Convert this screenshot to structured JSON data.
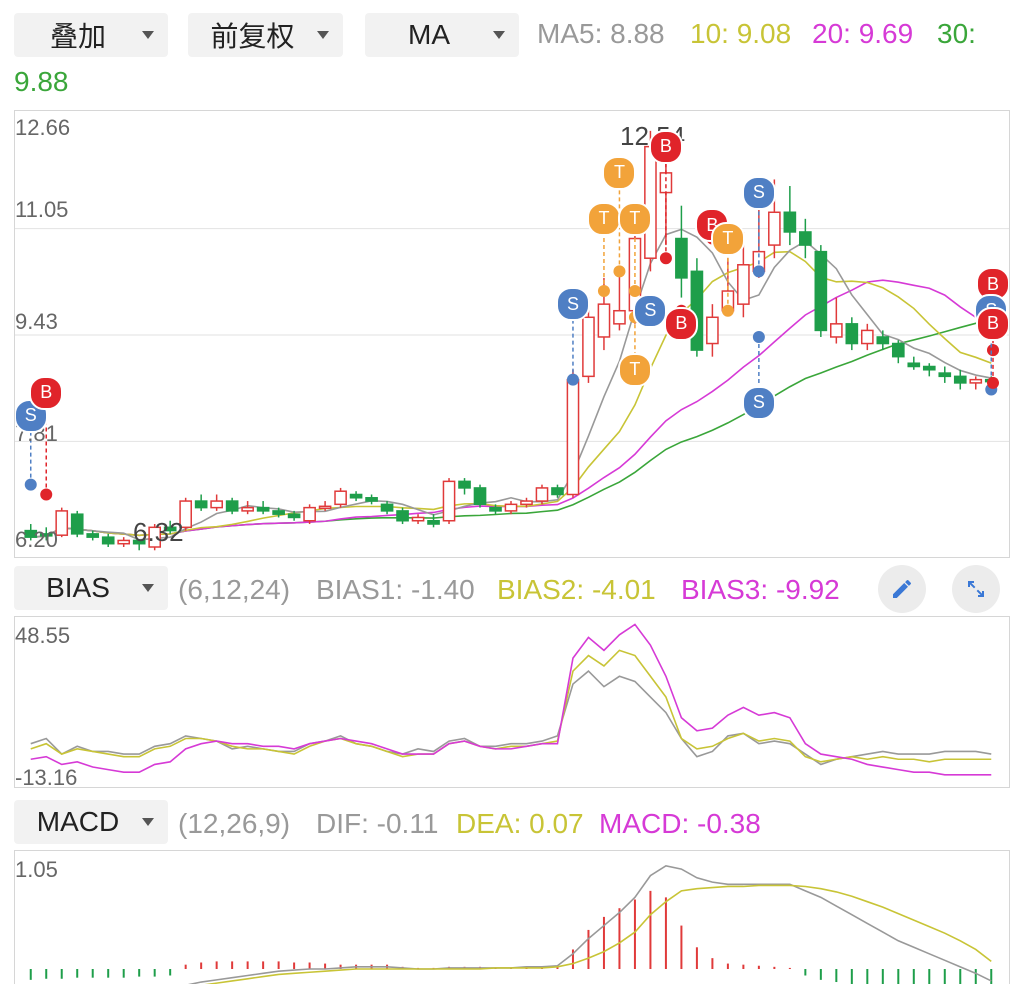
{
  "toolbar": {
    "overlay": "叠加",
    "adjust": "前复权",
    "indicator": "MA",
    "ma5": "MA5: 8.88",
    "ma10": "10: 9.08",
    "ma20": "20: 9.69",
    "ma30_label": "30:",
    "ma30_value": "9.88"
  },
  "main_chart": {
    "y_max": "12.66",
    "y_mid1": "11.05",
    "y_mid2": "9.43",
    "y_mid3": "7.81",
    "y_min": "6.20",
    "high_label": "12.54",
    "low_label": "6.32"
  },
  "bias_bar": {
    "indicator": "BIAS",
    "params": "(6,12,24)",
    "bias1": "BIAS1: -1.40",
    "bias2": "BIAS2: -4.01",
    "bias3": "BIAS3: -9.92"
  },
  "bias_chart": {
    "y_max": "48.55",
    "y_min": "-13.16"
  },
  "macd_bar": {
    "indicator": "MACD",
    "params": "(12,26,9)",
    "dif": "DIF: -0.11",
    "dea": "DEA: 0.07",
    "macd": "MACD: -0.38"
  },
  "macd_chart": {
    "y_max": "1.05"
  },
  "markers": {
    "buy": "B",
    "sell": "S",
    "t": "T"
  },
  "colors": {
    "up": "#e03a3a",
    "down": "#1e9e4a",
    "ma5": "#999999",
    "ma10": "#c8c436",
    "ma20": "#d63ad6",
    "ma30": "#3aa63a",
    "buy": "#e0242a",
    "sell": "#4f7fc4",
    "t": "#f2a33a"
  },
  "chart_data": [
    {
      "type": "candlestick",
      "title": "",
      "ylim": [
        6.2,
        12.66
      ],
      "candles": [
        [
          6.45,
          6.35,
          6.55,
          6.3
        ],
        [
          6.4,
          6.38,
          6.5,
          6.3
        ],
        [
          6.38,
          6.75,
          6.8,
          6.35
        ],
        [
          6.7,
          6.4,
          6.75,
          6.35
        ],
        [
          6.4,
          6.35,
          6.45,
          6.3
        ],
        [
          6.35,
          6.25,
          6.4,
          6.2
        ],
        [
          6.25,
          6.3,
          6.35,
          6.2
        ],
        [
          6.3,
          6.25,
          6.32,
          6.15
        ],
        [
          6.2,
          6.5,
          6.55,
          6.15
        ],
        [
          6.5,
          6.45,
          6.6,
          6.4
        ],
        [
          6.5,
          6.9,
          6.95,
          6.45
        ],
        [
          6.9,
          6.8,
          7.0,
          6.75
        ],
        [
          6.8,
          6.9,
          7.0,
          6.75
        ],
        [
          6.9,
          6.75,
          6.95,
          6.7
        ],
        [
          6.75,
          6.8,
          6.9,
          6.7
        ],
        [
          6.8,
          6.75,
          6.9,
          6.7
        ],
        [
          6.75,
          6.7,
          6.8,
          6.65
        ],
        [
          6.7,
          6.65,
          6.75,
          6.6
        ],
        [
          6.6,
          6.8,
          6.85,
          6.55
        ],
        [
          6.8,
          6.82,
          6.9,
          6.75
        ],
        [
          6.85,
          7.05,
          7.1,
          6.8
        ],
        [
          7.0,
          6.95,
          7.05,
          6.9
        ],
        [
          6.95,
          6.9,
          7.0,
          6.85
        ],
        [
          6.85,
          6.75,
          6.9,
          6.7
        ],
        [
          6.75,
          6.6,
          6.8,
          6.55
        ],
        [
          6.6,
          6.65,
          6.7,
          6.55
        ],
        [
          6.6,
          6.55,
          6.7,
          6.5
        ],
        [
          6.6,
          7.2,
          7.25,
          6.55
        ],
        [
          7.2,
          7.1,
          7.25,
          7.0
        ],
        [
          7.1,
          6.85,
          7.15,
          6.8
        ],
        [
          6.8,
          6.75,
          6.85,
          6.7
        ],
        [
          6.75,
          6.85,
          6.9,
          6.7
        ],
        [
          6.85,
          6.9,
          6.95,
          6.8
        ],
        [
          6.9,
          7.1,
          7.15,
          6.85
        ],
        [
          7.1,
          7.0,
          7.15,
          6.95
        ],
        [
          7.0,
          8.75,
          8.9,
          6.95
        ],
        [
          8.8,
          9.7,
          10.0,
          8.7
        ],
        [
          9.4,
          9.9,
          10.3,
          9.2
        ],
        [
          9.6,
          9.8,
          10.4,
          9.5
        ],
        [
          9.8,
          10.9,
          11.1,
          9.6
        ],
        [
          10.6,
          12.3,
          12.54,
          10.4
        ],
        [
          11.6,
          11.9,
          12.2,
          10.8
        ],
        [
          10.9,
          10.3,
          11.4,
          10.0
        ],
        [
          10.4,
          9.2,
          10.6,
          9.1
        ],
        [
          9.3,
          9.7,
          9.9,
          9.1
        ],
        [
          9.8,
          10.1,
          10.6,
          9.8
        ],
        [
          9.9,
          10.5,
          11.0,
          9.7
        ],
        [
          10.4,
          10.7,
          11.5,
          10.3
        ],
        [
          10.8,
          11.3,
          11.8,
          10.6
        ],
        [
          11.3,
          11.0,
          11.7,
          10.8
        ],
        [
          11.0,
          10.8,
          11.2,
          10.6
        ],
        [
          10.7,
          9.5,
          10.8,
          9.4
        ],
        [
          9.4,
          9.6,
          10.0,
          9.3
        ],
        [
          9.6,
          9.3,
          9.7,
          9.2
        ],
        [
          9.3,
          9.5,
          9.6,
          9.2
        ],
        [
          9.4,
          9.3,
          9.5,
          9.2
        ],
        [
          9.3,
          9.1,
          9.35,
          9.0
        ],
        [
          9.0,
          8.95,
          9.1,
          8.9
        ],
        [
          8.95,
          8.9,
          9.0,
          8.8
        ],
        [
          8.85,
          8.8,
          8.95,
          8.7
        ],
        [
          8.8,
          8.7,
          8.9,
          8.6
        ],
        [
          8.7,
          8.75,
          8.8,
          8.6
        ],
        [
          8.75,
          8.72,
          8.8,
          8.65
        ]
      ]
    },
    {
      "type": "line",
      "title": "",
      "ylim": [
        -13.16,
        48.55
      ],
      "series": [
        {
          "name": "BIAS1",
          "values": [
            2,
            4,
            -2,
            1,
            -1,
            -1,
            -2,
            -2,
            1,
            2,
            5,
            4,
            3,
            0,
            1,
            0,
            -1,
            -1,
            2,
            3,
            5,
            2,
            1,
            -1,
            -2,
            0,
            -1,
            3,
            4,
            1,
            1,
            2,
            2,
            3,
            5,
            25,
            30,
            24,
            28,
            26,
            20,
            14,
            4,
            -3,
            -1,
            5,
            6,
            2,
            3,
            2,
            -2,
            -6,
            -4,
            -3,
            -2,
            -1,
            -2,
            -2,
            -2,
            -1,
            -1,
            -1,
            -2
          ]
        },
        {
          "name": "BIAS2",
          "values": [
            0,
            2,
            -2,
            0,
            -1,
            -2,
            -3,
            -3,
            0,
            1,
            4,
            4,
            3,
            1,
            0,
            0,
            -1,
            -2,
            1,
            3,
            4,
            2,
            1,
            -1,
            -3,
            -2,
            -2,
            2,
            3,
            1,
            0,
            1,
            1,
            2,
            3,
            30,
            36,
            32,
            38,
            36,
            28,
            20,
            4,
            0,
            1,
            4,
            6,
            3,
            4,
            3,
            -3,
            -5,
            -4,
            -3,
            -4,
            -3,
            -4,
            -4,
            -5,
            -4,
            -4,
            -4,
            -4
          ]
        },
        {
          "name": "BIAS3",
          "values": [
            -4,
            -3,
            -6,
            -5,
            -7,
            -8,
            -9,
            -9,
            -6,
            -5,
            0,
            2,
            3,
            2,
            2,
            1,
            1,
            0,
            2,
            3,
            4,
            3,
            2,
            0,
            -2,
            -2,
            -2,
            2,
            3,
            1,
            0,
            0,
            1,
            2,
            2,
            35,
            43,
            38,
            44,
            48,
            40,
            28,
            12,
            7,
            8,
            13,
            16,
            13,
            14,
            12,
            2,
            -2,
            -3,
            -4,
            -6,
            -7,
            -8,
            -9,
            -9,
            -10,
            -10,
            -10,
            -10
          ]
        }
      ]
    },
    {
      "type": "bar+line",
      "title": "",
      "ylim": [
        -0.3,
        1.05
      ],
      "series": [
        {
          "name": "DIF",
          "values": [
            -0.25,
            -0.24,
            -0.23,
            -0.22,
            -0.21,
            -0.2,
            -0.2,
            -0.19,
            -0.19,
            -0.18,
            -0.15,
            -0.12,
            -0.1,
            -0.08,
            -0.06,
            -0.04,
            -0.02,
            -0.01,
            0.0,
            0.0,
            0.01,
            0.02,
            0.02,
            0.02,
            0.01,
            0.0,
            0.0,
            0.01,
            0.01,
            0.01,
            0.01,
            0.01,
            0.02,
            0.02,
            0.03,
            0.14,
            0.28,
            0.4,
            0.52,
            0.66,
            0.86,
            0.95,
            0.92,
            0.84,
            0.8,
            0.78,
            0.78,
            0.78,
            0.78,
            0.78,
            0.72,
            0.66,
            0.58,
            0.5,
            0.42,
            0.34,
            0.26,
            0.2,
            0.14,
            0.08,
            0.02,
            -0.04,
            -0.11
          ]
        },
        {
          "name": "DEA",
          "values": [
            -0.25,
            -0.25,
            -0.24,
            -0.23,
            -0.22,
            -0.21,
            -0.2,
            -0.2,
            -0.19,
            -0.18,
            -0.17,
            -0.15,
            -0.13,
            -0.11,
            -0.09,
            -0.07,
            -0.05,
            -0.04,
            -0.03,
            -0.02,
            -0.01,
            0.0,
            0.0,
            0.0,
            0.0,
            0.0,
            0.0,
            0.0,
            0.0,
            0.0,
            0.01,
            0.01,
            0.01,
            0.01,
            0.02,
            0.05,
            0.1,
            0.16,
            0.24,
            0.34,
            0.5,
            0.62,
            0.72,
            0.74,
            0.75,
            0.76,
            0.76,
            0.77,
            0.77,
            0.77,
            0.76,
            0.74,
            0.71,
            0.67,
            0.62,
            0.57,
            0.51,
            0.45,
            0.39,
            0.33,
            0.26,
            0.18,
            0.07
          ]
        },
        {
          "name": "MACD",
          "values": [
            -0.1,
            -0.09,
            -0.09,
            -0.08,
            -0.08,
            -0.08,
            -0.08,
            -0.07,
            -0.07,
            -0.06,
            0.04,
            0.06,
            0.07,
            0.07,
            0.07,
            0.07,
            0.07,
            0.06,
            0.06,
            0.05,
            0.04,
            0.04,
            0.04,
            0.04,
            0.02,
            0.01,
            0.01,
            0.02,
            0.02,
            0.02,
            0.01,
            0.01,
            0.02,
            0.02,
            0.03,
            0.18,
            0.36,
            0.48,
            0.56,
            0.64,
            0.72,
            0.66,
            0.4,
            0.2,
            0.1,
            0.05,
            0.04,
            0.03,
            0.02,
            0.01,
            -0.06,
            -0.1,
            -0.12,
            -0.14,
            -0.16,
            -0.18,
            -0.2,
            -0.22,
            -0.24,
            -0.26,
            -0.28,
            -0.3,
            -0.38
          ]
        }
      ]
    }
  ]
}
